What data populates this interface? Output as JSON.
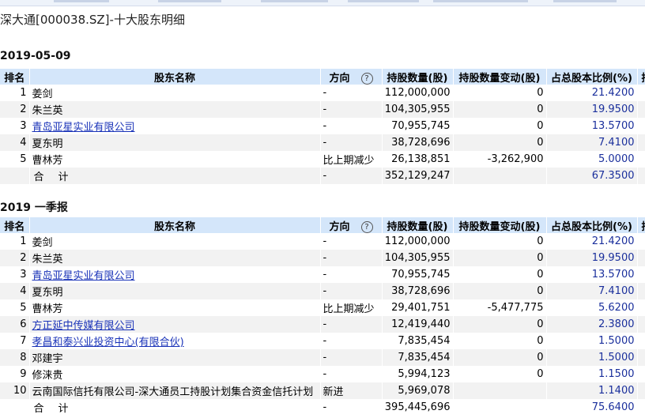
{
  "page": {
    "title": "深大通[000038.SZ]-十大股东明细"
  },
  "columns": [
    "排名",
    "股东名称",
    "方向",
    "持股数量(股)",
    "持股数量变动(股)",
    "占总股本比例(%)",
    "持"
  ],
  "sections": [
    {
      "label": "2019-05-09",
      "rows": [
        {
          "rank": "1",
          "name": "姜剑",
          "link": false,
          "direction": "-",
          "shares": "112,000,000",
          "change": "0",
          "pct": "21.4200"
        },
        {
          "rank": "2",
          "name": "朱兰英",
          "link": false,
          "direction": "-",
          "shares": "104,305,955",
          "change": "0",
          "pct": "19.9500"
        },
        {
          "rank": "3",
          "name": "青岛亚星实业有限公司",
          "link": true,
          "direction": "-",
          "shares": "70,955,745",
          "change": "0",
          "pct": "13.5700"
        },
        {
          "rank": "4",
          "name": "夏东明",
          "link": false,
          "direction": "-",
          "shares": "38,728,696",
          "change": "0",
          "pct": "7.4100"
        },
        {
          "rank": "5",
          "name": "曹林芳",
          "link": false,
          "direction": "比上期减少",
          "shares": "26,138,851",
          "change": "-3,262,900",
          "pct": "5.0000"
        }
      ],
      "total": {
        "label": "合计",
        "direction": "-",
        "shares": "352,129,247",
        "pct": "67.3500"
      }
    },
    {
      "label": "2019 一季报",
      "rows": [
        {
          "rank": "1",
          "name": "姜剑",
          "link": false,
          "direction": "-",
          "shares": "112,000,000",
          "change": "0",
          "pct": "21.4200"
        },
        {
          "rank": "2",
          "name": "朱兰英",
          "link": false,
          "direction": "-",
          "shares": "104,305,955",
          "change": "0",
          "pct": "19.9500"
        },
        {
          "rank": "3",
          "name": "青岛亚星实业有限公司",
          "link": true,
          "direction": "-",
          "shares": "70,955,745",
          "change": "0",
          "pct": "13.5700"
        },
        {
          "rank": "4",
          "name": "夏东明",
          "link": false,
          "direction": "-",
          "shares": "38,728,696",
          "change": "0",
          "pct": "7.4100"
        },
        {
          "rank": "5",
          "name": "曹林芳",
          "link": false,
          "direction": "比上期减少",
          "shares": "29,401,751",
          "change": "-5,477,775",
          "pct": "5.6200"
        },
        {
          "rank": "6",
          "name": "方正延中传媒有限公司",
          "link": true,
          "direction": "-",
          "shares": "12,419,440",
          "change": "0",
          "pct": "2.3800"
        },
        {
          "rank": "7",
          "name": "孝昌和泰兴业投资中心(有限合伙)",
          "link": true,
          "direction": "-",
          "shares": "7,835,454",
          "change": "0",
          "pct": "1.5000"
        },
        {
          "rank": "8",
          "name": "邓建宇",
          "link": false,
          "direction": "-",
          "shares": "7,835,454",
          "change": "0",
          "pct": "1.5000"
        },
        {
          "rank": "9",
          "name": "修涞贵",
          "link": false,
          "direction": "-",
          "shares": "5,994,123",
          "change": "0",
          "pct": "1.1500"
        },
        {
          "rank": "10",
          "name": "云南国际信托有限公司-深大通员工持股计划集合资金信托计划",
          "link": false,
          "direction": "新进",
          "shares": "5,969,078",
          "change": "",
          "pct": "1.1400"
        }
      ],
      "total": {
        "label": "合计",
        "direction": "-",
        "shares": "395,445,696",
        "pct": "75.6400"
      }
    }
  ],
  "colors": {
    "header_bg": "#d4e6fa",
    "stripe_bg": "#f2f2f2",
    "pct_text": "#1a2f9c",
    "link_text": "#1a33b8"
  },
  "icons": {
    "direction_help": "question-circle-icon"
  }
}
